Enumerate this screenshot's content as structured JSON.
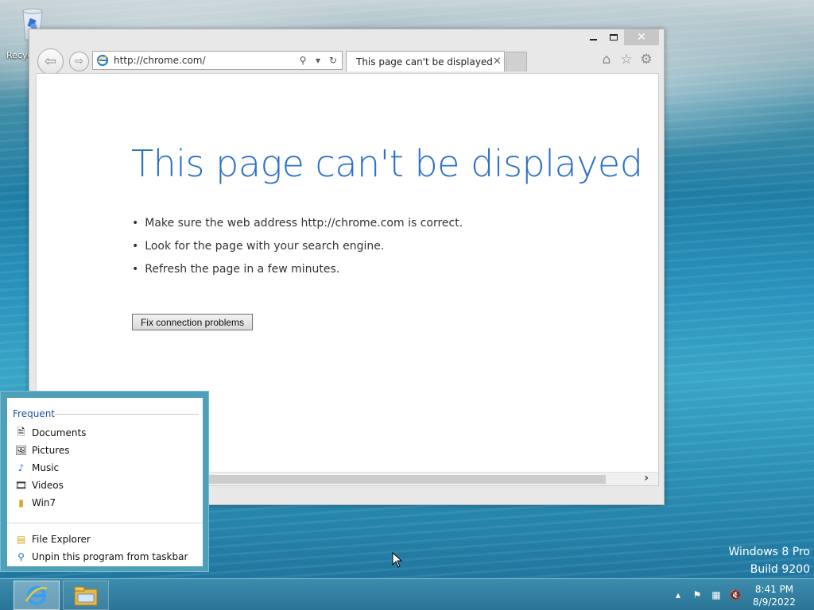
{
  "desktop": {
    "recycle_label": "Recyc",
    "watermark_line1": "Windows 8 Pro",
    "watermark_line2": "Build 9200"
  },
  "browser": {
    "address_url": "http://chrome.com/",
    "tab_title": "This page can't be displayed",
    "window_controls": {
      "minimize": "minimize",
      "maximize": "maximize",
      "close": "✕"
    },
    "toolbar_icons": [
      "home-icon",
      "star-icon",
      "gear-icon"
    ],
    "error": {
      "title": "This page can't be displayed",
      "bullets": [
        "Make sure the web address http://chrome.com is correct.",
        "Look for the page with your search engine.",
        "Refresh the page in a few minutes."
      ],
      "fix_button": "Fix connection problems"
    }
  },
  "jumplist": {
    "heading": "Frequent",
    "items": [
      {
        "label": "Documents",
        "icon": "documents-icon"
      },
      {
        "label": "Pictures",
        "icon": "pictures-icon"
      },
      {
        "label": "Music",
        "icon": "music-icon"
      },
      {
        "label": "Videos",
        "icon": "videos-icon"
      },
      {
        "label": "Win7",
        "icon": "folder-icon"
      }
    ],
    "tasks": [
      {
        "label": "File Explorer",
        "icon": "file-explorer-icon"
      },
      {
        "label": "Unpin this program from taskbar",
        "icon": "unpin-icon"
      }
    ]
  },
  "taskbar": {
    "time": "8:41 PM",
    "date": "8/9/2022"
  },
  "colors": {
    "error_title": "#2a6fc9",
    "jumplist_heading": "#1f4f9e",
    "taskbar": "#2a7597"
  }
}
